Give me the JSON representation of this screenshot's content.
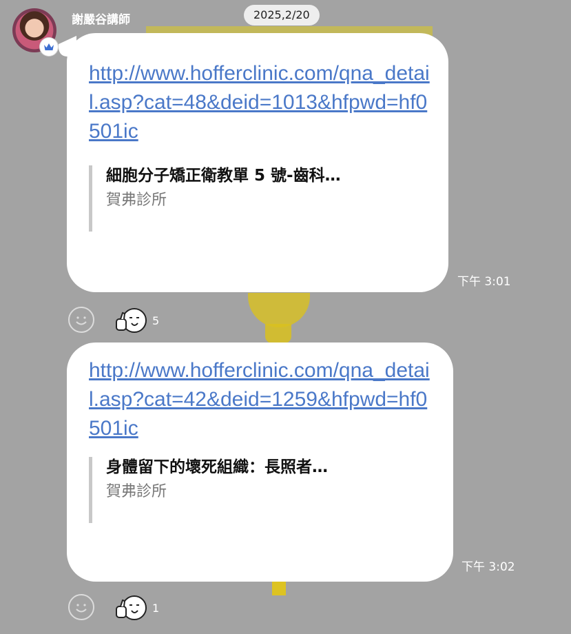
{
  "sender": {
    "name": "謝嚴谷講師"
  },
  "date_pill": "2025,2/20",
  "messages": [
    {
      "link": "http://www.hofferclinic.com/qna_detail.asp?cat=48&deid=1013&hfpwd=hf0501ic",
      "preview_title": "細胞分子矯正衛教單 5 號-齒科…",
      "preview_site": "賀弗診所",
      "time": "下午 3:01",
      "reaction_count": "5"
    },
    {
      "link": "http://www.hofferclinic.com/qna_detail.asp?cat=42&deid=1259&hfpwd=hf0501ic",
      "preview_title": "身體留下的壞死組織：長照者…",
      "preview_site": "賀弗診所",
      "time": "下午 3:02",
      "reaction_count": "1"
    }
  ],
  "icons": {
    "avatar": "profile-photo",
    "badge": "crown-icon",
    "add_reaction": "smiley-outline-icon",
    "reaction": "thumbs-up-face-emoji"
  },
  "colors": {
    "background": "#a3a3a3",
    "bubble": "#ffffff",
    "link": "#4a78c8",
    "crown": "#3d6fd1"
  }
}
